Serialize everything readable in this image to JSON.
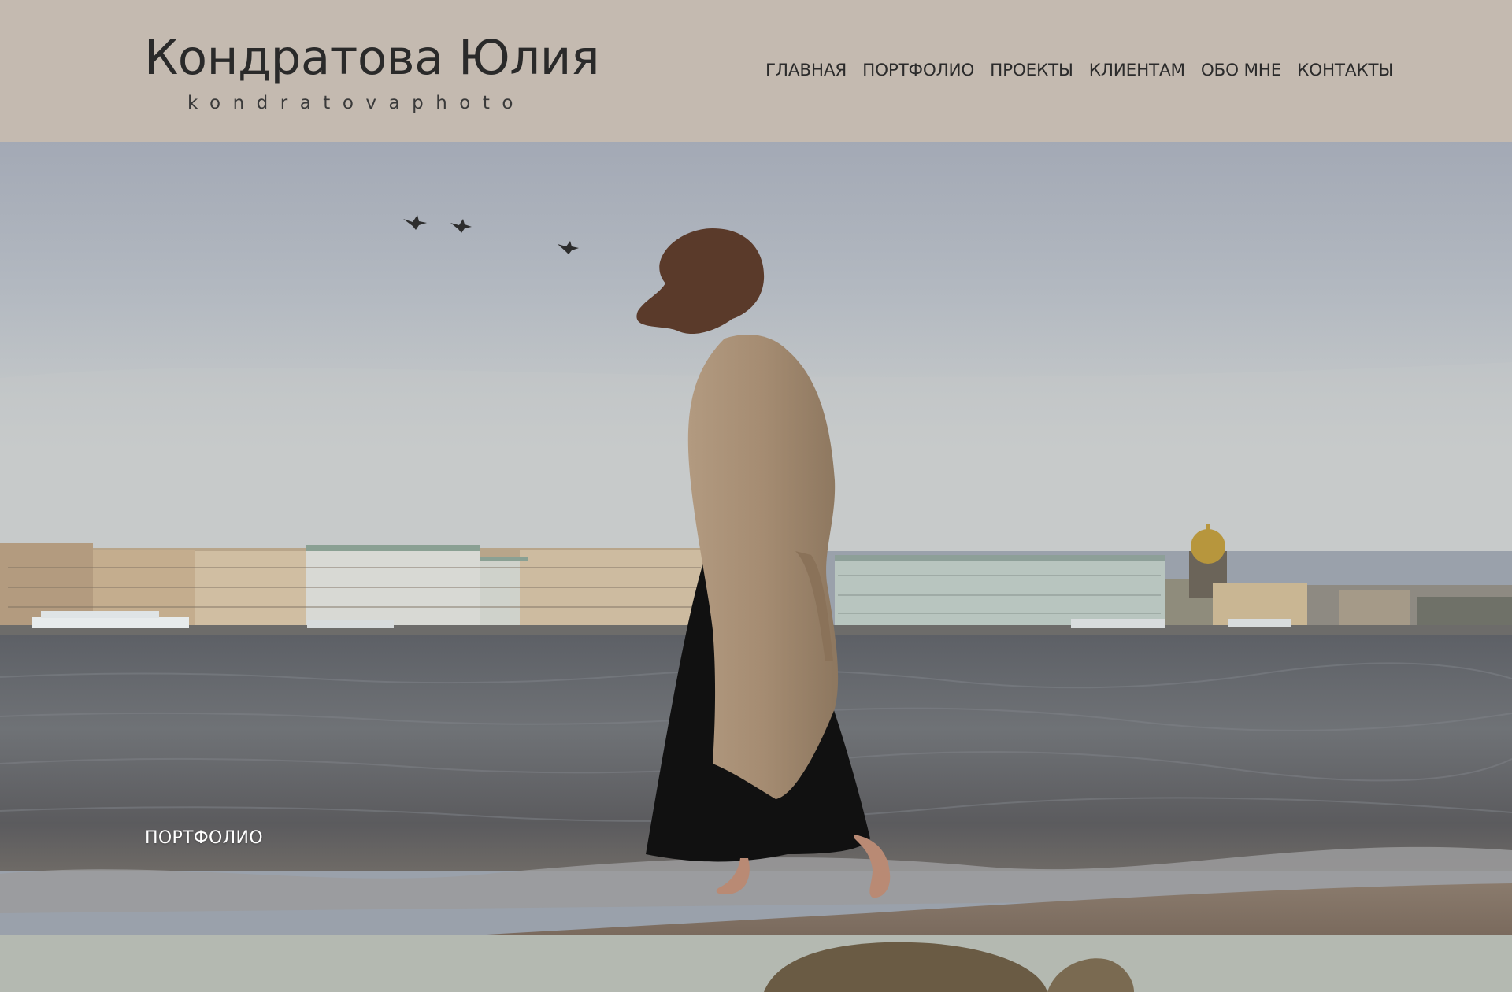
{
  "site": {
    "title": "Кондратова Юлия",
    "subtitle": "kondratovaphoto"
  },
  "nav": {
    "items": [
      {
        "label": "ГЛАВНАЯ"
      },
      {
        "label": "ПОРТФОЛИО"
      },
      {
        "label": "ПРОЕКТЫ"
      },
      {
        "label": "КЛИЕНТАМ"
      },
      {
        "label": "ОБО МНЕ"
      },
      {
        "label": "КОНТАКТЫ"
      }
    ]
  },
  "hero": {
    "caption": "ПОРТФОЛИО"
  },
  "colors": {
    "header_bg": "#c4bab0",
    "text": "#2a2a2a",
    "caption": "#ffffff"
  }
}
